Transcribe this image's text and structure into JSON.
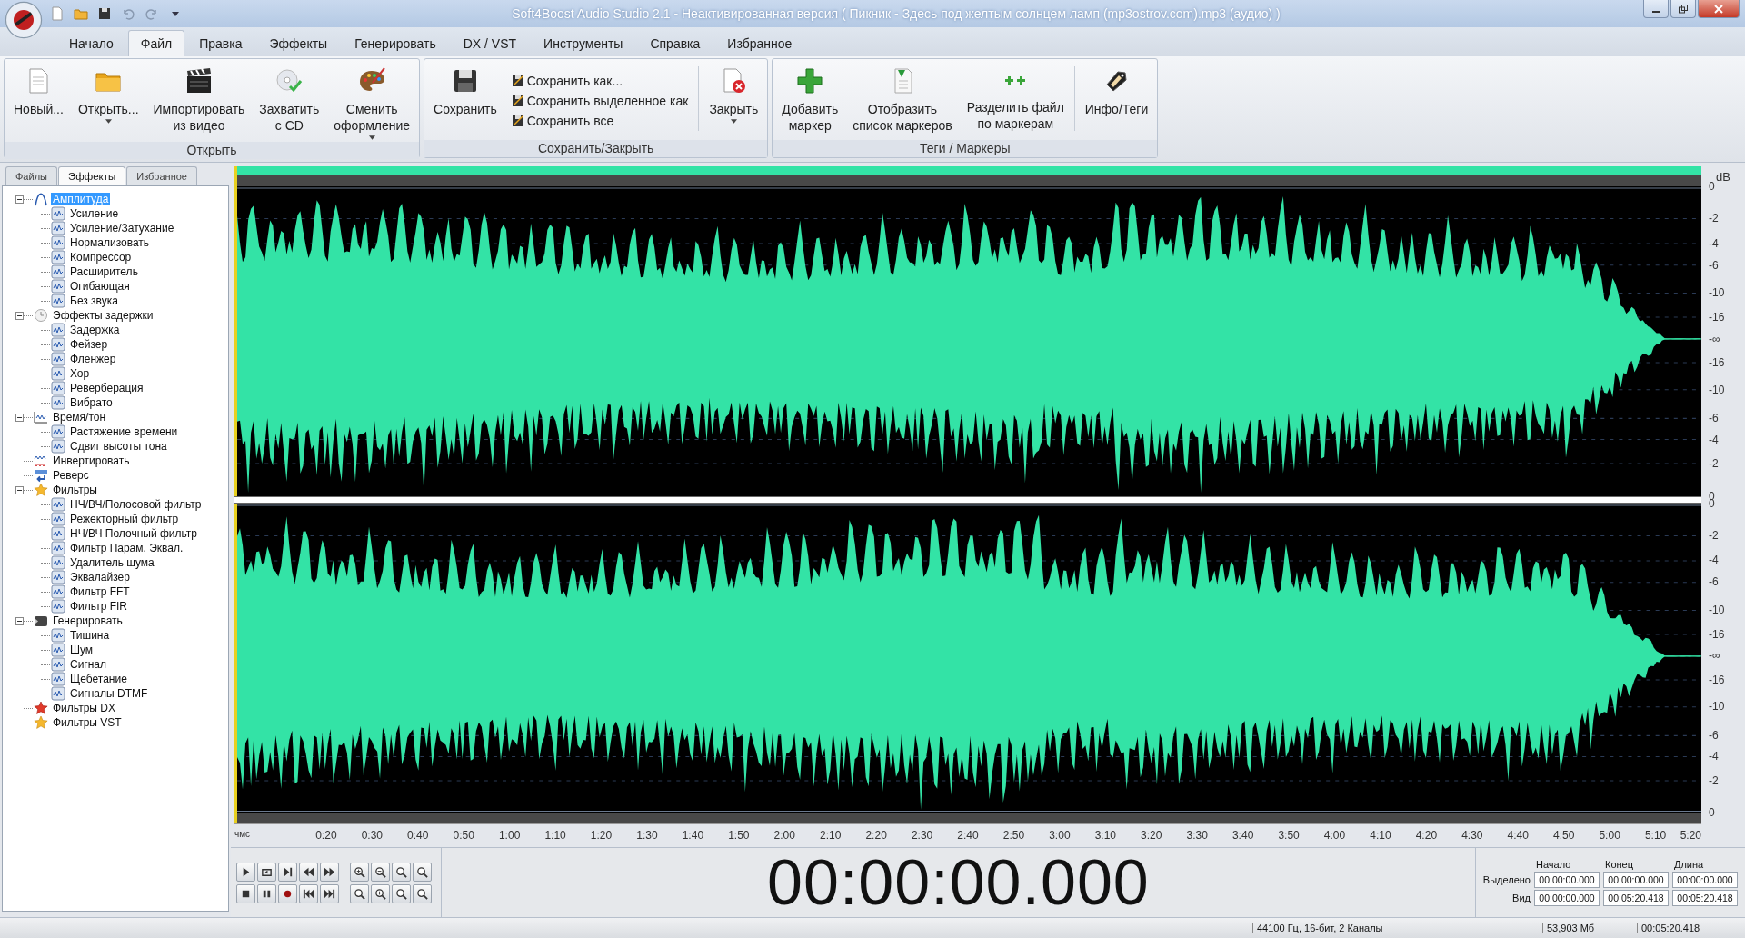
{
  "window": {
    "title": "Soft4Boost Audio Studio 2.1 - Неактивированная версия ( Пикник - Здесь под желтым солнцем ламп (mp3ostrov.com).mp3 (аудио) )"
  },
  "menu_tabs": [
    {
      "label": "Начало",
      "selected": false
    },
    {
      "label": "Файл",
      "selected": true
    },
    {
      "label": "Правка",
      "selected": false
    },
    {
      "label": "Эффекты",
      "selected": false
    },
    {
      "label": "Генерировать",
      "selected": false
    },
    {
      "label": "DX / VST",
      "selected": false
    },
    {
      "label": "Инструменты",
      "selected": false
    },
    {
      "label": "Справка",
      "selected": false
    },
    {
      "label": "Избранное",
      "selected": false
    }
  ],
  "ribbon": [
    {
      "title": "Открыть",
      "buttons": [
        {
          "label": "Новый...",
          "dropdown": false
        },
        {
          "label": "Открыть...",
          "dropdown": true
        },
        {
          "label": "Импортировать\nиз видео",
          "dropdown": false
        },
        {
          "label": "Захватить\nс CD",
          "dropdown": false
        },
        {
          "label": "Сменить\nоформление",
          "dropdown": true
        }
      ]
    },
    {
      "title": "Сохранить/Закрыть",
      "buttons": [
        {
          "label": "Сохранить",
          "dropdown": false
        },
        {
          "label": "Закрыть",
          "dropdown": true
        }
      ],
      "small_buttons": [
        "Сохранить как...",
        "Сохранить выделенное как",
        "Сохранить все"
      ]
    },
    {
      "title": "Теги / Маркеры",
      "buttons": [
        {
          "label": "Добавить\nмаркер",
          "dropdown": false
        },
        {
          "label": "Отобразить\nсписок маркеров",
          "dropdown": false
        },
        {
          "label": "Разделить файл\nпо маркерам",
          "dropdown": false
        },
        {
          "label": "Инфо/Теги",
          "dropdown": false
        }
      ]
    }
  ],
  "sidebar": {
    "tabs": [
      {
        "label": "Файлы",
        "selected": false
      },
      {
        "label": "Эффекты",
        "selected": true
      },
      {
        "label": "Избранное",
        "selected": false
      }
    ],
    "tree": [
      {
        "label": "Амплитуда",
        "selected": true,
        "expanded": true,
        "children": [
          {
            "label": "Усиление"
          },
          {
            "label": "Усиление/Затухание"
          },
          {
            "label": "Нормализовать"
          },
          {
            "label": "Компрессор"
          },
          {
            "label": "Расширитель"
          },
          {
            "label": "Огибающая"
          },
          {
            "label": "Без звука"
          }
        ]
      },
      {
        "label": "Эффекты задержки",
        "selected": false,
        "expanded": true,
        "children": [
          {
            "label": "Задержка"
          },
          {
            "label": "Фейзер"
          },
          {
            "label": "Фленжер"
          },
          {
            "label": "Хор"
          },
          {
            "label": "Реверберация"
          },
          {
            "label": "Вибрато"
          }
        ]
      },
      {
        "label": "Время/тон",
        "selected": false,
        "expanded": true,
        "children": [
          {
            "label": "Растяжение времени"
          },
          {
            "label": "Сдвиг высоты тона"
          }
        ]
      },
      {
        "label": "Инвертировать",
        "selected": false
      },
      {
        "label": "Реверс",
        "selected": false
      },
      {
        "label": "Фильтры",
        "selected": false,
        "expanded": true,
        "children": [
          {
            "label": "НЧ/ВЧ/Полосовой фильтр"
          },
          {
            "label": "Режекторный фильтр"
          },
          {
            "label": "НЧ/ВЧ Полочный фильтр"
          },
          {
            "label": "Фильтр Парам. Эквал."
          },
          {
            "label": "Удалитель шума"
          },
          {
            "label": "Эквалайзер"
          },
          {
            "label": "Фильтр FFT"
          },
          {
            "label": "Фильтр FIR"
          }
        ]
      },
      {
        "label": "Генерировать",
        "selected": false,
        "expanded": true,
        "children": [
          {
            "label": "Тишина"
          },
          {
            "label": "Шум"
          },
          {
            "label": "Сигнал"
          },
          {
            "label": "Щебетание"
          },
          {
            "label": "Сигналы DTMF"
          }
        ]
      },
      {
        "label": "Фильтры DX",
        "selected": false
      },
      {
        "label": "Фильтры VST",
        "selected": false
      }
    ]
  },
  "db_scale": {
    "unit": "dB",
    "channels": [
      [
        "0",
        "-2",
        "-4",
        "-6",
        "-10",
        "-16",
        "-∞",
        "-16",
        "-10",
        "-6",
        "-4",
        "-2",
        "0"
      ],
      [
        "0",
        "-2",
        "-4",
        "-6",
        "-10",
        "-16",
        "-∞",
        "-16",
        "-10",
        "-6",
        "-4",
        "-2",
        "0"
      ]
    ]
  },
  "time_ruler": {
    "unit_label": "чмс",
    "ticks": [
      "0:20",
      "0:30",
      "0:40",
      "0:50",
      "1:00",
      "1:10",
      "1:20",
      "1:30",
      "1:40",
      "1:50",
      "2:00",
      "2:10",
      "2:20",
      "2:30",
      "2:40",
      "2:50",
      "3:00",
      "3:10",
      "3:20",
      "3:30",
      "3:40",
      "3:50",
      "4:00",
      "4:10",
      "4:20",
      "4:30",
      "4:40",
      "4:50",
      "5:00",
      "5:10",
      "5:20"
    ]
  },
  "time_display": "00:00:00.000",
  "selection_panel": {
    "columns": [
      "Начало",
      "Конец",
      "Длина"
    ],
    "rows": [
      {
        "label": "Выделено",
        "values": [
          "00:00:00.000",
          "00:00:00.000",
          "00:00:00.000"
        ]
      },
      {
        "label": "Вид",
        "values": [
          "00:00:00.000",
          "00:05:20.418",
          "00:05:20.418"
        ]
      }
    ]
  },
  "status_bar": [
    "44100 Гц, 16-бит, 2 Каналы",
    "53,903 Мб",
    "00:05:20.418"
  ]
}
